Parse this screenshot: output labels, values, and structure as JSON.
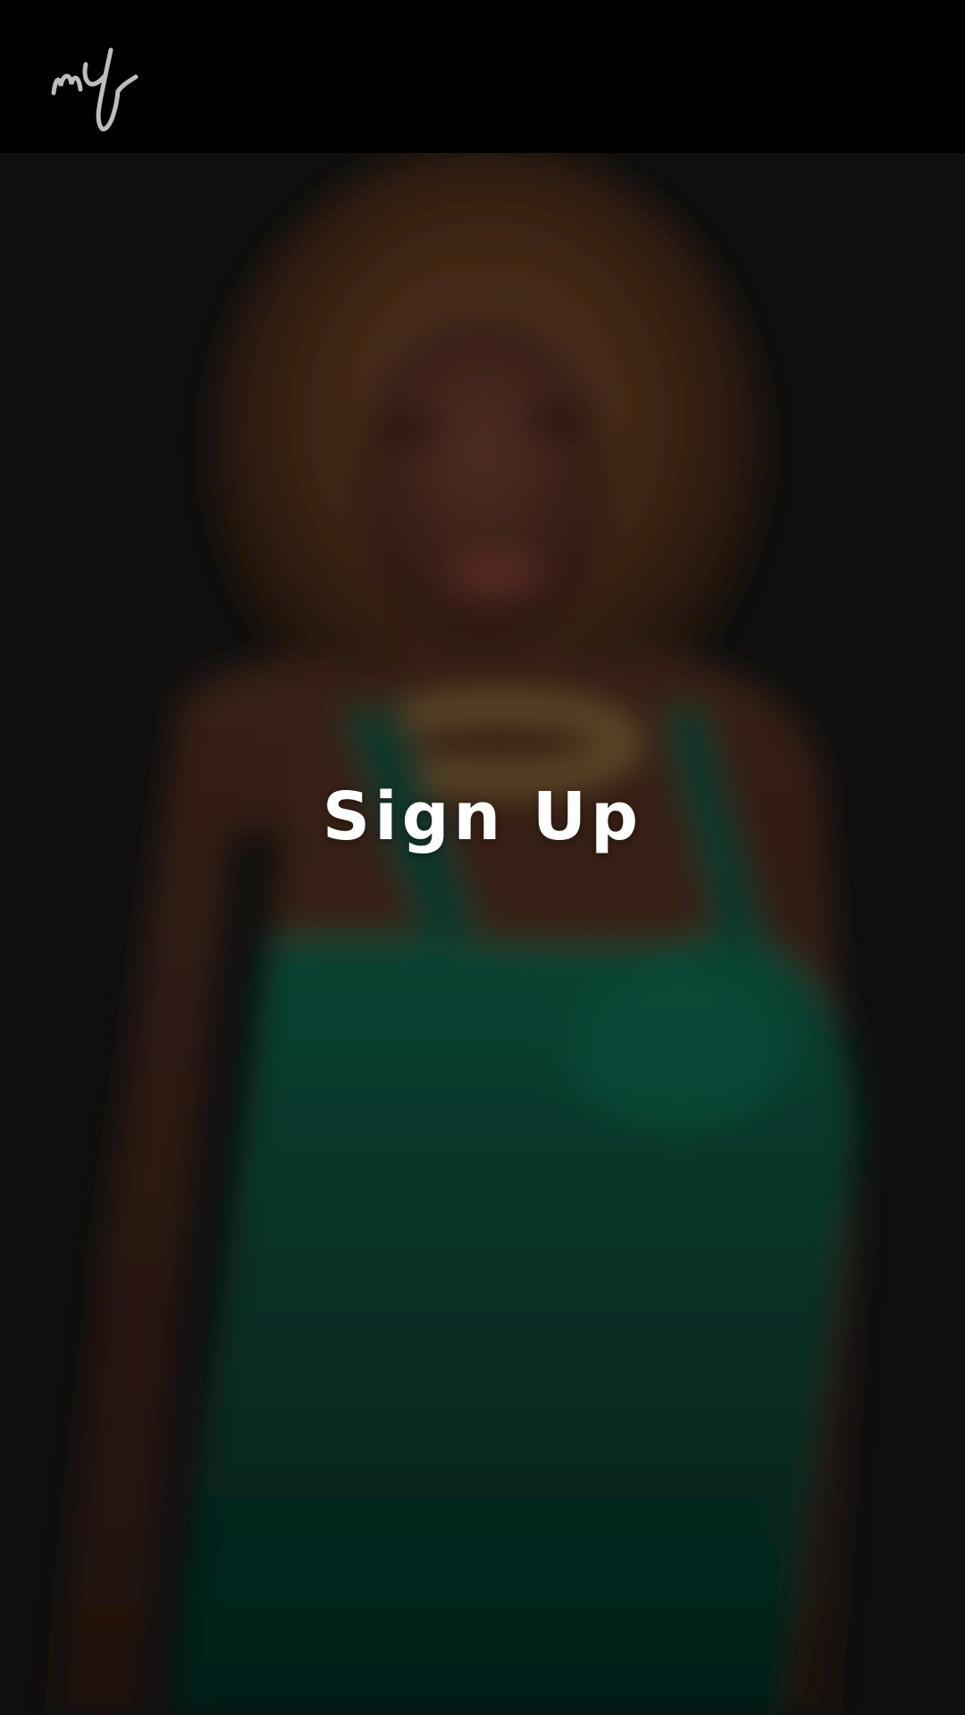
{
  "header": {
    "logo_icon": "my-script-logo"
  },
  "hero": {
    "background_image": "blurred-portrait-woman-green-dress",
    "signup_label": "Sign Up"
  },
  "colors": {
    "header_bg": "#000000",
    "hero_bg": "#141414",
    "dress": "#0a4a38",
    "skin": "#4a2a1e",
    "hair": "#6b4426",
    "text": "#ffffff",
    "logo": "#bdbdbd"
  }
}
